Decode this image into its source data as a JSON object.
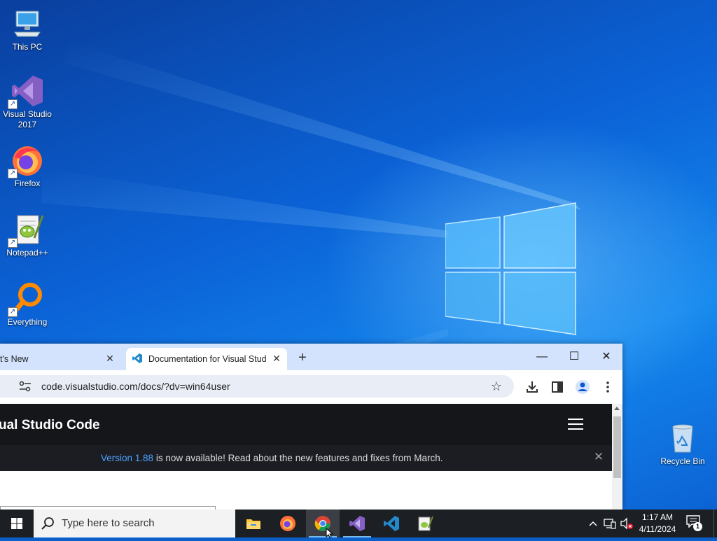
{
  "desktop": {
    "icons": [
      {
        "label": "This PC"
      },
      {
        "label": "Visual Studio 2017"
      },
      {
        "label": "Firefox"
      },
      {
        "label": "Notepad++"
      },
      {
        "label": "Everything"
      },
      {
        "label": "Recycle Bin"
      }
    ]
  },
  "browser": {
    "tabs": [
      {
        "label": "t's New",
        "close": "✕"
      },
      {
        "label": "Documentation for Visual Studio",
        "close": "✕",
        "active": true
      }
    ],
    "new_tab": "+",
    "window_controls": {
      "minimize": "—",
      "maximize": "☐",
      "close": "✕"
    },
    "address": {
      "url": "code.visualstudio.com/docs/?dv=win64user"
    },
    "page": {
      "site_title": "ual Studio Code",
      "banner": {
        "link_text": "Version 1.88",
        "text": " is now available! Read about the new features and fixes from March.",
        "close": "✕"
      }
    }
  },
  "taskbar": {
    "search_placeholder": "Type here to search",
    "apps": [
      "File Explorer",
      "Firefox",
      "Google Chrome",
      "Visual Studio 2017",
      "Visual Studio Code",
      "Notepad++"
    ],
    "clock": {
      "time": "1:17 AM",
      "date": "4/11/2024"
    },
    "notification_count": "1",
    "tray_chevron": "^"
  },
  "colors": {
    "wallpaper": "#0b62d6",
    "taskbar": "#1c1f24",
    "tabstrip": "#d3e3fd",
    "site_header": "#15161a",
    "link": "#4aa3ff",
    "running_indicator": "#76b9ed"
  }
}
